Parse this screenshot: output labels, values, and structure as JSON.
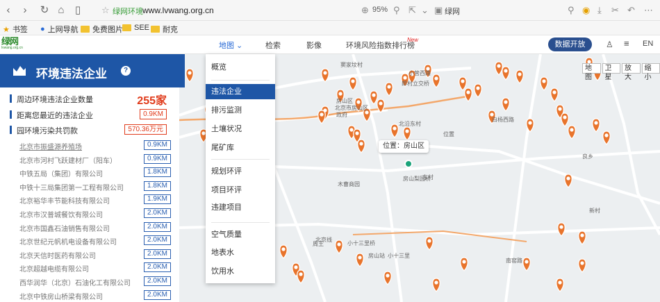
{
  "browser": {
    "site_label": "绿网环境",
    "url": "www.lvwang.org.cn",
    "zoom": "95%",
    "extension_label": "绿网"
  },
  "bookmarks": [
    {
      "label": "书签",
      "icon": "star-icon"
    },
    {
      "label": "上网导航",
      "icon": "globe-icon"
    },
    {
      "label": "免费图片",
      "icon": "folder-icon"
    },
    {
      "label": "SEE",
      "icon": "folder-icon"
    },
    {
      "label": "耐克",
      "icon": "folder-icon"
    }
  ],
  "header": {
    "nav": [
      {
        "label": "地图 ⌄"
      },
      {
        "label": "检索"
      },
      {
        "label": "影像"
      },
      {
        "label": "环境风险指数排行榜"
      }
    ],
    "new_badge": "New",
    "data_open": "数据开放",
    "lang": "EN"
  },
  "panel": {
    "title": "环境违法企业",
    "help": "?",
    "stats": [
      {
        "label": "周边环境违法企业数量",
        "value": "255家"
      },
      {
        "label": "距离您最近的违法企业",
        "value": "0.9KM"
      },
      {
        "label": "园环境污染共罚款",
        "value": "570.36万元"
      }
    ],
    "enterprises": [
      {
        "name": "北京市振盛源养殖场",
        "dist": "0.9KM"
      },
      {
        "name": "北京市河村飞跃建材厂（阳车）",
        "dist": "0.9KM"
      },
      {
        "name": "中铁五局（集团）有限公司",
        "dist": "1.8KM"
      },
      {
        "name": "中铁十三局集团第一工程有限公司",
        "dist": "1.8KM"
      },
      {
        "name": "北京裕华丰节能科技有限公司",
        "dist": "1.9KM"
      },
      {
        "name": "北京市汉普城餐饮有限公司",
        "dist": "2.0KM"
      },
      {
        "name": "北京市国鑫石油销售有限公司",
        "dist": "2.0KM"
      },
      {
        "name": "北京世纪元帆机电设备有限公司",
        "dist": "2.0KM"
      },
      {
        "name": "北京天信时医药有限公司",
        "dist": "2.0KM"
      },
      {
        "name": "北京超越电缆有限公司",
        "dist": "2.0KM"
      },
      {
        "name": "西华润华（北京）石油化工有限公司",
        "dist": "2.0KM"
      },
      {
        "name": "北京中铁房山桥梁有限公司",
        "dist": "2.0KM"
      }
    ]
  },
  "dropdown": {
    "items": [
      "概览",
      "违法企业",
      "排污监测",
      "土壤状况",
      "尾矿库",
      "规划环评",
      "项目环评",
      "违建项目",
      "空气质量",
      "地表水",
      "饮用水"
    ],
    "active": "违法企业"
  },
  "map": {
    "location_tip": "位置：房山区",
    "controls": [
      "地图",
      "卫星",
      "放大",
      "缩小"
    ],
    "labels": [
      "窦家坟村",
      "小营西路",
      "郎村立交桥",
      "房山区",
      "北京市房山区",
      "政府",
      "北沿东村",
      "白杨西路",
      "位置",
      "房山梨园桥",
      "木曹商园",
      "房山站",
      "北京线",
      "周王",
      "小十三里桥",
      "小十三里",
      "南窑路",
      "东村",
      "良乡",
      "新村"
    ],
    "pin_color": "#e8742c"
  }
}
